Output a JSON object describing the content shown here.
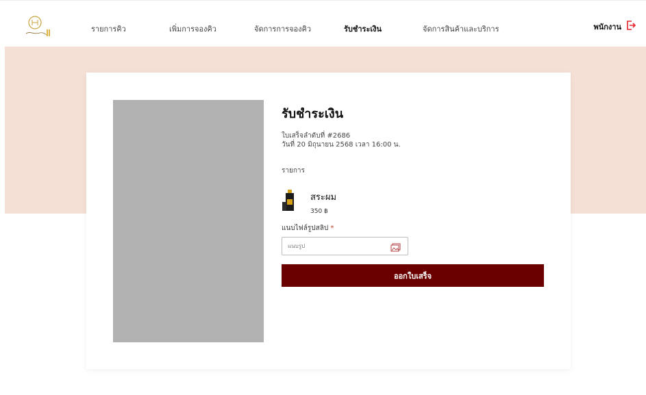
{
  "nav": {
    "items": [
      {
        "label": "รายการคิว",
        "active": false
      },
      {
        "label": "เพิ่มการจองคิว",
        "active": false
      },
      {
        "label": "จัดการการจองคิว",
        "active": false
      },
      {
        "label": "รับชำระเงิน",
        "active": true
      },
      {
        "label": "จัดการสินค้าและบริการ",
        "active": false
      }
    ],
    "user_label": "พนักงาน"
  },
  "payment": {
    "title": "รับชำระเงิน",
    "receipt_number": "ใบเสร็จลำดับที่ #2686",
    "datetime": "วันที่ 20 มิถุนายน 2568 เวลา 16:00 น.",
    "items_label": "รายการ",
    "items": [
      {
        "name": "สระผม",
        "price": "350 ฿"
      }
    ],
    "slip_label": "แนบไฟล์รูปสลิป",
    "required_mark": "*",
    "slip_placeholder": "แนบรูป",
    "submit_label": "ออกใบเสร็จ"
  },
  "colors": {
    "accent": "#6a0000",
    "band": "#f4e0d5",
    "placeholder_image": "#b1b1b1",
    "logout_icon": "#e8202a"
  }
}
